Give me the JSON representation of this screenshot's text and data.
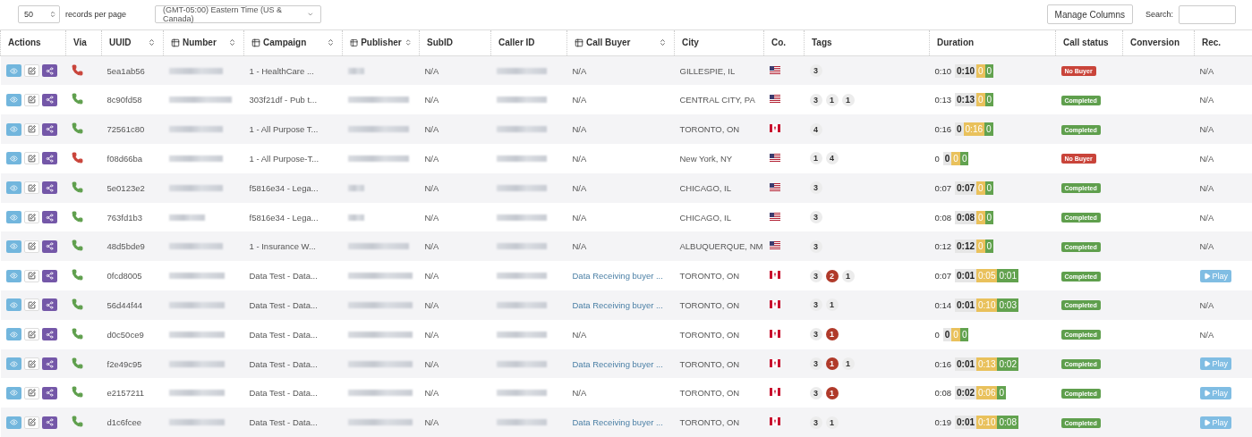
{
  "toolbar": {
    "page_size": "50",
    "page_size_label": "records per page",
    "timezone": "(GMT-05:00) Eastern Time (US & Canada)",
    "manage_columns": "Manage Columns",
    "search_label": "Search:"
  },
  "columns": [
    {
      "label": "Actions",
      "icon": false,
      "sortable": false
    },
    {
      "label": "Via",
      "icon": false,
      "sortable": false
    },
    {
      "label": "UUID",
      "icon": false,
      "sortable": true
    },
    {
      "label": "Number",
      "icon": true,
      "sortable": true
    },
    {
      "label": "Campaign",
      "icon": true,
      "sortable": true
    },
    {
      "label": "Publisher",
      "icon": true,
      "sortable": true
    },
    {
      "label": "SubID",
      "icon": false,
      "sortable": false
    },
    {
      "label": "Caller ID",
      "icon": false,
      "sortable": false
    },
    {
      "label": "Call Buyer",
      "icon": true,
      "sortable": true
    },
    {
      "label": "City",
      "icon": false,
      "sortable": false
    },
    {
      "label": "Co.",
      "icon": false,
      "sortable": false
    },
    {
      "label": "Tags",
      "icon": false,
      "sortable": false
    },
    {
      "label": "Duration",
      "icon": false,
      "sortable": false
    },
    {
      "label": "Call status",
      "icon": false,
      "sortable": false
    },
    {
      "label": "Conversion",
      "icon": false,
      "sortable": false
    },
    {
      "label": "Rec.",
      "icon": false,
      "sortable": false
    }
  ],
  "rows": [
    {
      "via_ok": false,
      "uuid": "5ea1ab56",
      "campaign": "1 - HealthCare ...",
      "subid": "N/A",
      "buyer": {
        "kind": "text",
        "text": "N/A"
      },
      "city": "GILLESPIE, IL",
      "country": {
        "kind": "us"
      },
      "tags": [
        {
          "text": "3",
          "alert": false
        }
      ],
      "duration": {
        "total": "0:10",
        "segments": [
          {
            "kind": "base",
            "text": "0:10"
          },
          {
            "kind": "hold",
            "text": "0"
          },
          {
            "kind": "talk",
            "text": "0"
          }
        ]
      },
      "status": {
        "kind": "no-buyer",
        "text": "No Buyer"
      },
      "rec": {
        "kind": "text",
        "text": "N/A"
      }
    },
    {
      "via_ok": true,
      "uuid": "8c90fd58",
      "campaign": "303f21df - Pub t...",
      "subid": "N/A",
      "buyer": {
        "kind": "text",
        "text": "N/A"
      },
      "city": "CENTRAL CITY, PA",
      "country": {
        "kind": "us"
      },
      "tags": [
        {
          "text": "3",
          "alert": false
        },
        {
          "text": "1",
          "alert": false
        },
        {
          "text": "1",
          "alert": false
        }
      ],
      "duration": {
        "total": "0:13",
        "segments": [
          {
            "kind": "base",
            "text": "0:13"
          },
          {
            "kind": "hold",
            "text": "0"
          },
          {
            "kind": "talk",
            "text": "0"
          }
        ]
      },
      "status": {
        "kind": "completed",
        "text": "Completed"
      },
      "rec": {
        "kind": "text",
        "text": "N/A"
      }
    },
    {
      "via_ok": true,
      "uuid": "72561c80",
      "campaign": "1 - All Purpose T...",
      "subid": "N/A",
      "buyer": {
        "kind": "text",
        "text": "N/A"
      },
      "city": "TORONTO, ON",
      "country": {
        "kind": "ca"
      },
      "tags": [
        {
          "text": "4",
          "alert": false
        }
      ],
      "duration": {
        "total": "0:16",
        "segments": [
          {
            "kind": "base",
            "text": "0"
          },
          {
            "kind": "hold",
            "text": "0:16"
          },
          {
            "kind": "talk",
            "text": "0"
          }
        ]
      },
      "status": {
        "kind": "completed",
        "text": "Completed"
      },
      "rec": {
        "kind": "text",
        "text": "N/A"
      }
    },
    {
      "via_ok": false,
      "uuid": "f08d66ba",
      "campaign": "1 - All Purpose-T...",
      "subid": "N/A",
      "buyer": {
        "kind": "text",
        "text": "N/A"
      },
      "city": "New York, NY",
      "country": {
        "kind": "us"
      },
      "tags": [
        {
          "text": "1",
          "alert": false
        },
        {
          "text": "4",
          "alert": false
        }
      ],
      "duration": {
        "total": "0",
        "segments": [
          {
            "kind": "base",
            "text": "0"
          },
          {
            "kind": "hold",
            "text": "0"
          },
          {
            "kind": "talk",
            "text": "0"
          }
        ]
      },
      "status": {
        "kind": "no-buyer",
        "text": "No Buyer"
      },
      "rec": {
        "kind": "text",
        "text": "N/A"
      }
    },
    {
      "via_ok": true,
      "uuid": "5e0123e2",
      "campaign": "f5816e34 - Lega...",
      "subid": "N/A",
      "buyer": {
        "kind": "text",
        "text": "N/A"
      },
      "city": "CHICAGO, IL",
      "country": {
        "kind": "us"
      },
      "tags": [
        {
          "text": "3",
          "alert": false
        }
      ],
      "duration": {
        "total": "0:07",
        "segments": [
          {
            "kind": "base",
            "text": "0:07"
          },
          {
            "kind": "hold",
            "text": "0"
          },
          {
            "kind": "talk",
            "text": "0"
          }
        ]
      },
      "status": {
        "kind": "completed",
        "text": "Completed"
      },
      "rec": {
        "kind": "text",
        "text": "N/A"
      }
    },
    {
      "via_ok": true,
      "uuid": "763fd1b3",
      "campaign": "f5816e34 - Lega...",
      "subid": "N/A",
      "buyer": {
        "kind": "text",
        "text": "N/A"
      },
      "city": "CHICAGO, IL",
      "country": {
        "kind": "us"
      },
      "tags": [
        {
          "text": "3",
          "alert": false
        }
      ],
      "duration": {
        "total": "0:08",
        "segments": [
          {
            "kind": "base",
            "text": "0:08"
          },
          {
            "kind": "hold",
            "text": "0"
          },
          {
            "kind": "talk",
            "text": "0"
          }
        ]
      },
      "status": {
        "kind": "completed",
        "text": "Completed"
      },
      "rec": {
        "kind": "text",
        "text": "N/A"
      }
    },
    {
      "via_ok": true,
      "uuid": "48d5bde9",
      "campaign": "1 - Insurance W...",
      "subid": "N/A",
      "buyer": {
        "kind": "text",
        "text": "N/A"
      },
      "city": "ALBUQUERQUE, NM",
      "country": {
        "kind": "us"
      },
      "tags": [
        {
          "text": "3",
          "alert": false
        }
      ],
      "duration": {
        "total": "0:12",
        "segments": [
          {
            "kind": "base",
            "text": "0:12"
          },
          {
            "kind": "hold",
            "text": "0"
          },
          {
            "kind": "talk",
            "text": "0"
          }
        ]
      },
      "status": {
        "kind": "completed",
        "text": "Completed"
      },
      "rec": {
        "kind": "text",
        "text": "N/A"
      }
    },
    {
      "via_ok": true,
      "uuid": "0fcd8005",
      "campaign": "Data Test - Data...",
      "subid": "N/A",
      "buyer": {
        "kind": "link",
        "text": "Data Receiving buyer ..."
      },
      "city": "TORONTO, ON",
      "country": {
        "kind": "ca"
      },
      "tags": [
        {
          "text": "3",
          "alert": false
        },
        {
          "text": "2",
          "alert": true
        },
        {
          "text": "1",
          "alert": false
        }
      ],
      "duration": {
        "total": "0:07",
        "segments": [
          {
            "kind": "base",
            "text": "0:01"
          },
          {
            "kind": "hold",
            "text": "0:05"
          },
          {
            "kind": "talk",
            "text": "0:01"
          }
        ]
      },
      "status": {
        "kind": "completed",
        "text": "Completed"
      },
      "rec": {
        "kind": "play",
        "text": "Play"
      }
    },
    {
      "via_ok": true,
      "uuid": "56d44f44",
      "campaign": "Data Test - Data...",
      "subid": "N/A",
      "buyer": {
        "kind": "link",
        "text": "Data Receiving buyer ..."
      },
      "city": "TORONTO, ON",
      "country": {
        "kind": "ca"
      },
      "tags": [
        {
          "text": "3",
          "alert": false
        },
        {
          "text": "1",
          "alert": false
        }
      ],
      "duration": {
        "total": "0:14",
        "segments": [
          {
            "kind": "base",
            "text": "0:01"
          },
          {
            "kind": "hold",
            "text": "0:10"
          },
          {
            "kind": "talk",
            "text": "0:03"
          }
        ]
      },
      "status": {
        "kind": "completed",
        "text": "Completed"
      },
      "rec": {
        "kind": "text",
        "text": "N/A"
      }
    },
    {
      "via_ok": true,
      "uuid": "d0c50ce9",
      "campaign": "Data Test - Data...",
      "subid": "N/A",
      "buyer": {
        "kind": "text",
        "text": "N/A"
      },
      "city": "TORONTO, ON",
      "country": {
        "kind": "ca"
      },
      "tags": [
        {
          "text": "3",
          "alert": false
        },
        {
          "text": "1",
          "alert": true
        }
      ],
      "duration": {
        "total": "0",
        "segments": [
          {
            "kind": "base",
            "text": "0"
          },
          {
            "kind": "hold",
            "text": "0"
          },
          {
            "kind": "talk",
            "text": "0"
          }
        ]
      },
      "status": {
        "kind": "completed",
        "text": "Completed"
      },
      "rec": {
        "kind": "text",
        "text": "N/A"
      }
    },
    {
      "via_ok": true,
      "uuid": "f2e49c95",
      "campaign": "Data Test - Data...",
      "subid": "N/A",
      "buyer": {
        "kind": "link",
        "text": "Data Receiving buyer ..."
      },
      "city": "TORONTO, ON",
      "country": {
        "kind": "ca"
      },
      "tags": [
        {
          "text": "3",
          "alert": false
        },
        {
          "text": "1",
          "alert": true
        },
        {
          "text": "1",
          "alert": false
        }
      ],
      "duration": {
        "total": "0:16",
        "segments": [
          {
            "kind": "base",
            "text": "0:01"
          },
          {
            "kind": "hold",
            "text": "0:13"
          },
          {
            "kind": "talk",
            "text": "0:02"
          }
        ]
      },
      "status": {
        "kind": "completed",
        "text": "Completed"
      },
      "rec": {
        "kind": "play",
        "text": "Play"
      }
    },
    {
      "via_ok": true,
      "uuid": "e2157211",
      "campaign": "Data Test - Data...",
      "subid": "N/A",
      "buyer": {
        "kind": "text",
        "text": "N/A"
      },
      "city": "TORONTO, ON",
      "country": {
        "kind": "ca"
      },
      "tags": [
        {
          "text": "3",
          "alert": false
        },
        {
          "text": "1",
          "alert": true
        }
      ],
      "duration": {
        "total": "0:08",
        "segments": [
          {
            "kind": "base",
            "text": "0:02"
          },
          {
            "kind": "hold",
            "text": "0:06"
          },
          {
            "kind": "talk",
            "text": "0"
          }
        ]
      },
      "status": {
        "kind": "completed",
        "text": "Completed"
      },
      "rec": {
        "kind": "play",
        "text": "Play"
      }
    },
    {
      "via_ok": true,
      "uuid": "d1c6fcee",
      "campaign": "Data Test - Data...",
      "subid": "N/A",
      "buyer": {
        "kind": "link",
        "text": "Data Receiving buyer ..."
      },
      "city": "TORONTO, ON",
      "country": {
        "kind": "ca"
      },
      "tags": [
        {
          "text": "3",
          "alert": false
        },
        {
          "text": "1",
          "alert": false
        }
      ],
      "duration": {
        "total": "0:19",
        "segments": [
          {
            "kind": "base",
            "text": "0:01"
          },
          {
            "kind": "hold",
            "text": "0:10"
          },
          {
            "kind": "talk",
            "text": "0:08"
          }
        ]
      },
      "status": {
        "kind": "completed",
        "text": "Completed"
      },
      "rec": {
        "kind": "play",
        "text": "Play"
      }
    }
  ]
}
